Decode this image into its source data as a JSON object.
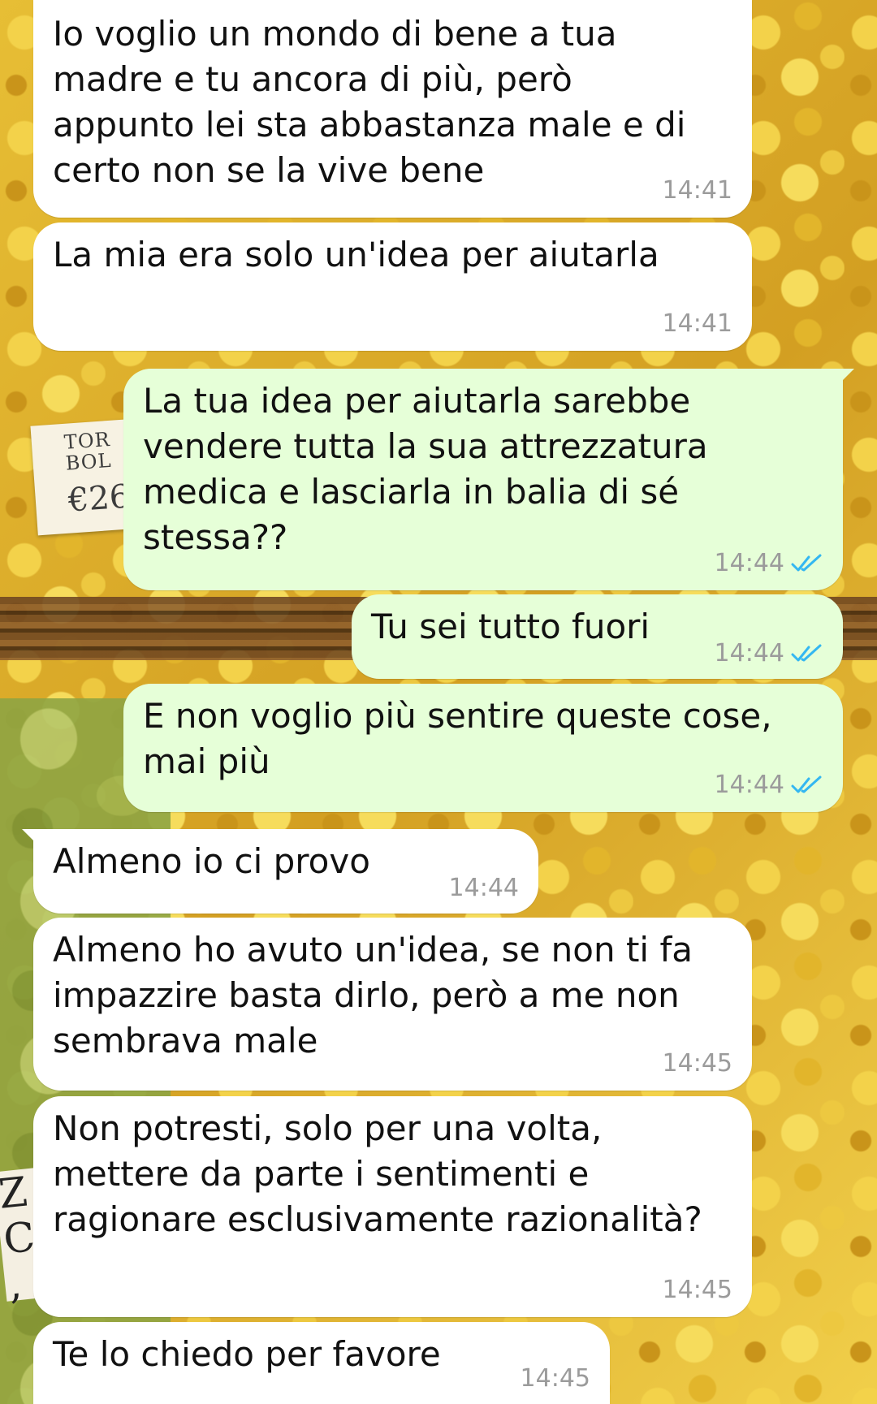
{
  "chat": {
    "colors": {
      "incoming_bubble": "#ffffff",
      "outgoing_bubble": "#e6ffd8",
      "timestamp": "#9b9b9b",
      "read_ticks": "#34b7f1"
    },
    "wallpaper": {
      "tag_line1": "TOR",
      "tag_line2": "BOL",
      "tag_price": "€26",
      "sign_line1": "Z",
      "sign_line2": "C",
      "sign_line3": ","
    },
    "messages": [
      {
        "direction": "incoming",
        "text": "Io voglio un mondo di bene a tua\nmadre e tu ancora di più, però\nappunto lei sta abbastanza male e di\ncerto non se la vive bene",
        "time": "14:41"
      },
      {
        "direction": "incoming",
        "text": "La mia era solo un'idea per aiutarla",
        "time": "14:41"
      },
      {
        "direction": "outgoing",
        "text": "La tua idea per aiutarla sarebbe\nvendere tutta la sua attrezzatura\nmedica e lasciarla in balia di sé\nstessa??",
        "time": "14:44",
        "status": "read-ticks-icon"
      },
      {
        "direction": "outgoing",
        "text": "Tu sei tutto fuori",
        "time": "14:44",
        "status": "read-ticks-icon"
      },
      {
        "direction": "outgoing",
        "text": "E non voglio più sentire queste cose,\nmai più",
        "time": "14:44",
        "status": "read-ticks-icon"
      },
      {
        "direction": "incoming",
        "text": "Almeno io ci provo",
        "time": "14:44"
      },
      {
        "direction": "incoming",
        "text": "Almeno ho avuto un'idea, se non ti fa\nimpazzire basta dirlo, però a me non\nsembrava male",
        "time": "14:45"
      },
      {
        "direction": "incoming",
        "text": "Non potresti, solo per una volta,\nmettere da parte i sentimenti e\nragionare esclusivamente razionalità?",
        "time": "14:45"
      },
      {
        "direction": "incoming",
        "text": "Te lo chiedo per favore",
        "time": "14:45"
      }
    ]
  }
}
